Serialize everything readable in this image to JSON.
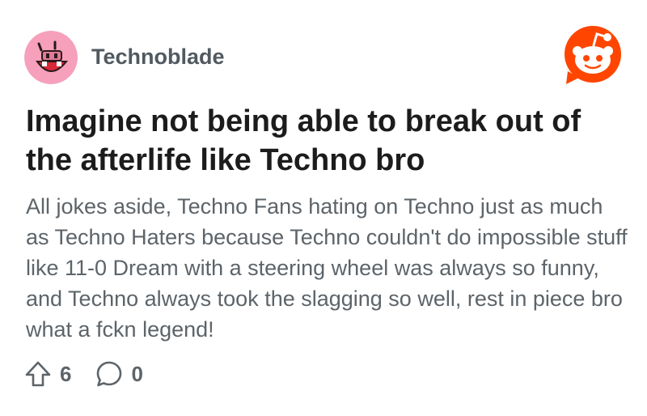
{
  "post": {
    "author": "Technoblade",
    "title": "Imagine not being able to break out of the afterlife like Techno bro",
    "body": "All jokes aside, Techno Fans hating on Techno just as much as Techno Haters because Techno couldn't do impossible stuff like 11-0 Dream with a steering wheel was always so funny, and Techno always took the slagging so well, rest in piece bro what a fckn legend!",
    "upvotes": "6",
    "comments": "0"
  },
  "icons": {
    "avatar": "pig-face-avatar",
    "brand": "reddit-logo-icon",
    "upvote": "upvote-arrow-icon",
    "comment": "comment-bubble-icon"
  },
  "colors": {
    "brand": "#ff4500",
    "avatar_bg": "#f6a0bb",
    "title": "#1c1c1c",
    "body": "#5d6469"
  }
}
